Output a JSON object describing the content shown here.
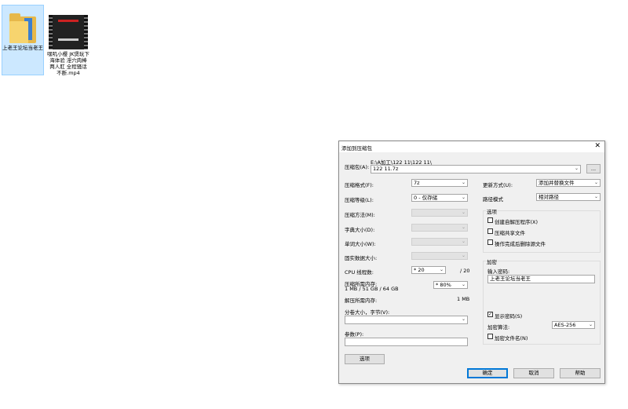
{
  "desktop": {
    "icons": [
      {
        "label": "上老王论坛当老王",
        "type": "folder",
        "selected": true
      },
      {
        "label": "嘿叽小樱 JK煲玩下海体验 淫穴肉棒两人肛 全程骚话不断.mp4",
        "type": "video",
        "selected": false
      }
    ]
  },
  "dialog": {
    "title": "添加到压缩包",
    "close_glyph": "✕",
    "archive": {
      "label": "压缩包(A):",
      "path": "E:\\A加工\\122 11\\122 11\\",
      "filename": "122 11.7z",
      "browse_label": "..."
    },
    "left": {
      "format_label": "压缩格式(F):",
      "format_value": "7z",
      "level_label": "压缩等级(L):",
      "level_value": "0 - 仅存储",
      "method_label": "压缩方法(M):",
      "dict_label": "字典大小(D):",
      "word_label": "单词大小(W):",
      "solid_label": "固实数据大小:",
      "cpu_label": "CPU 线程数:",
      "cpu_value": "* 20",
      "cpu_total": "/ 20",
      "mem_label": "压缩所需内存:",
      "mem_detail": "1 MB / 51 GB / 64 GB",
      "mem_value": "* 80%",
      "decomp_label": "解压所需内存:",
      "decomp_value": "1 MB",
      "split_label": "分卷大小，字节(V):",
      "params_label": "参数(P):",
      "options_button": "选项"
    },
    "right": {
      "update_label": "更新方式(U):",
      "update_value": "添加并替换文件",
      "path_label": "路径模式",
      "path_value": "相对路径",
      "options_group": "选项",
      "opt_sfx": "创建自解压程序(X)",
      "opt_shared": "压缩共享文件",
      "opt_delete": "操作完成后删除源文件",
      "encrypt_group": "加密",
      "password_label": "输入密码:",
      "password_value": "上老王论坛当老王",
      "show_password": "显示密码(S)",
      "show_password_checked": "✓",
      "enc_method_label": "加密算法:",
      "enc_method_value": "AES-256",
      "encrypt_names": "加密文件名(N)"
    },
    "buttons": {
      "ok": "确定",
      "cancel": "取消",
      "help": "帮助"
    },
    "arrow_glyph": "⌄"
  }
}
